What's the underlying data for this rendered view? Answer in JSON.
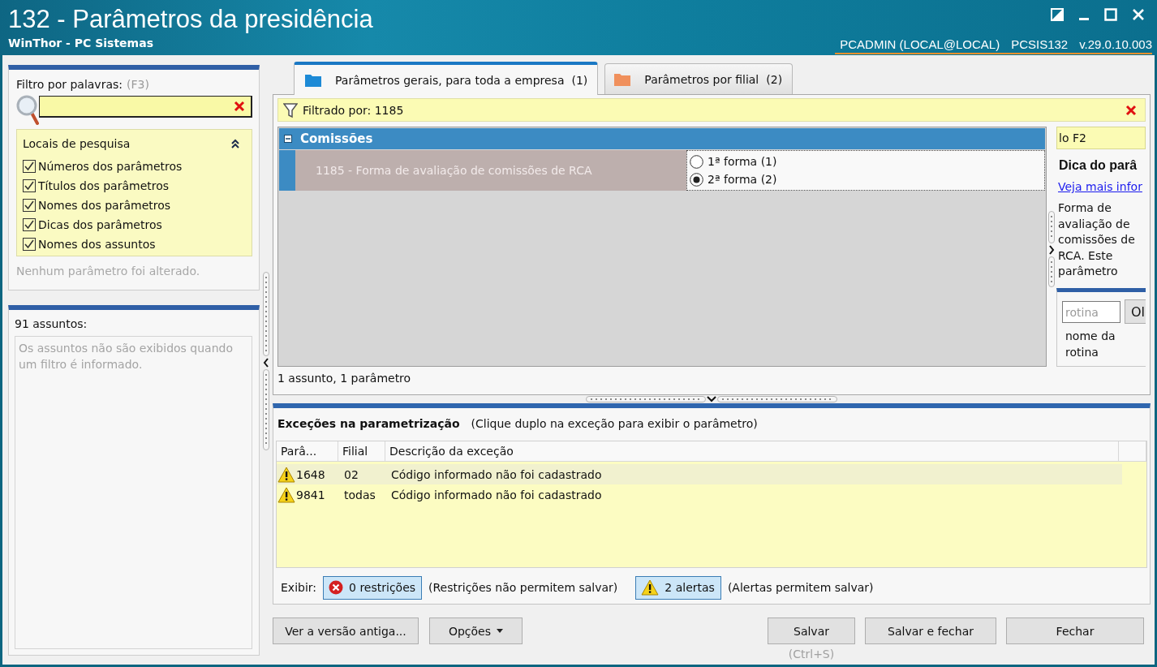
{
  "window": {
    "title": "132 - Parâmetros da presidência",
    "subtitle": "WinThor - PC Sistemas",
    "user": "PCADMIN (LOCAL@LOCAL)",
    "program": "PCSIS132",
    "version": "v.29.0.10.003"
  },
  "filter_panel": {
    "label": "Filtro por palavras:",
    "shortcut": "(F3)",
    "search_locations": {
      "title": "Locais de pesquisa",
      "expanded": true,
      "options": [
        {
          "label": "Números dos parâmetros",
          "checked": true
        },
        {
          "label": "Títulos dos parâmetros",
          "checked": true
        },
        {
          "label": "Nomes dos parâmetros",
          "checked": true
        },
        {
          "label": "Dicas dos parâmetros",
          "checked": true
        },
        {
          "label": "Nomes dos assuntos",
          "checked": true
        }
      ]
    },
    "status": "Nenhum parâmetro foi alterado."
  },
  "subjects_panel": {
    "count": "91 assuntos:",
    "message": "Os assuntos não são exibidos quando um filtro é informado."
  },
  "tabs": [
    {
      "label": "Parâmetros gerais, para toda a empresa",
      "count": "(1)",
      "selected": true,
      "color": "#1d8ad6"
    },
    {
      "label": "Parâmetros por filial",
      "count": "(2)",
      "selected": false,
      "color": "#f0905c"
    }
  ],
  "filter_bar": {
    "text": "Filtrado por: 1185"
  },
  "parameters": {
    "groups": [
      {
        "title": "Comissões",
        "expanded": true,
        "items": [
          {
            "label": "1185 - Forma de avaliação de comissões de RCA",
            "options": [
              {
                "label": "1ª forma (1)",
                "selected": false
              },
              {
                "label": "2ª forma (2)",
                "selected": true
              }
            ]
          }
        ]
      }
    ],
    "summary": "1 assunto, 1 parâmetro"
  },
  "hint_panel": {
    "search_hint": "lo F2",
    "title": "Dica do parâ",
    "link": "Veja mais infor",
    "text": "Forma de avaliação de comissões de RCA. Este parâmetro",
    "routine_field": {
      "placeholder": "rotina"
    },
    "routine_button": "Ol",
    "routine_label": "nome da rotina"
  },
  "exceptions": {
    "title": "Exceções na parametrização",
    "hint": "(Clique duplo na exceção para exibir o parâmetro)",
    "columns": [
      "Parâ...",
      "Filial",
      "Descrição da exceção"
    ],
    "rows": [
      {
        "kind": "alert",
        "selected": true,
        "cells": [
          "1648",
          "02",
          "Código informado não foi cadastrado"
        ]
      },
      {
        "kind": "alert",
        "selected": false,
        "cells": [
          "9841",
          "todas",
          "Código informado não foi cadastrado"
        ]
      }
    ],
    "show_label": "Exibir:",
    "toggles": [
      {
        "kind": "restriction",
        "label": "0 restrições",
        "on": true,
        "note": "(Restrições não permitem salvar)"
      },
      {
        "kind": "alert",
        "label": "2 alertas",
        "on": true,
        "note": "(Alertas permitem salvar)"
      }
    ]
  },
  "footer": {
    "left_buttons": [
      {
        "label": "Ver a versão antiga...",
        "menu": false
      },
      {
        "label": "Opções",
        "menu": true
      }
    ],
    "right_buttons": [
      {
        "label": "Salvar",
        "shortcut": "(Ctrl+S)"
      },
      {
        "label": "Salvar e fechar"
      },
      {
        "label": "Fechar"
      }
    ]
  }
}
